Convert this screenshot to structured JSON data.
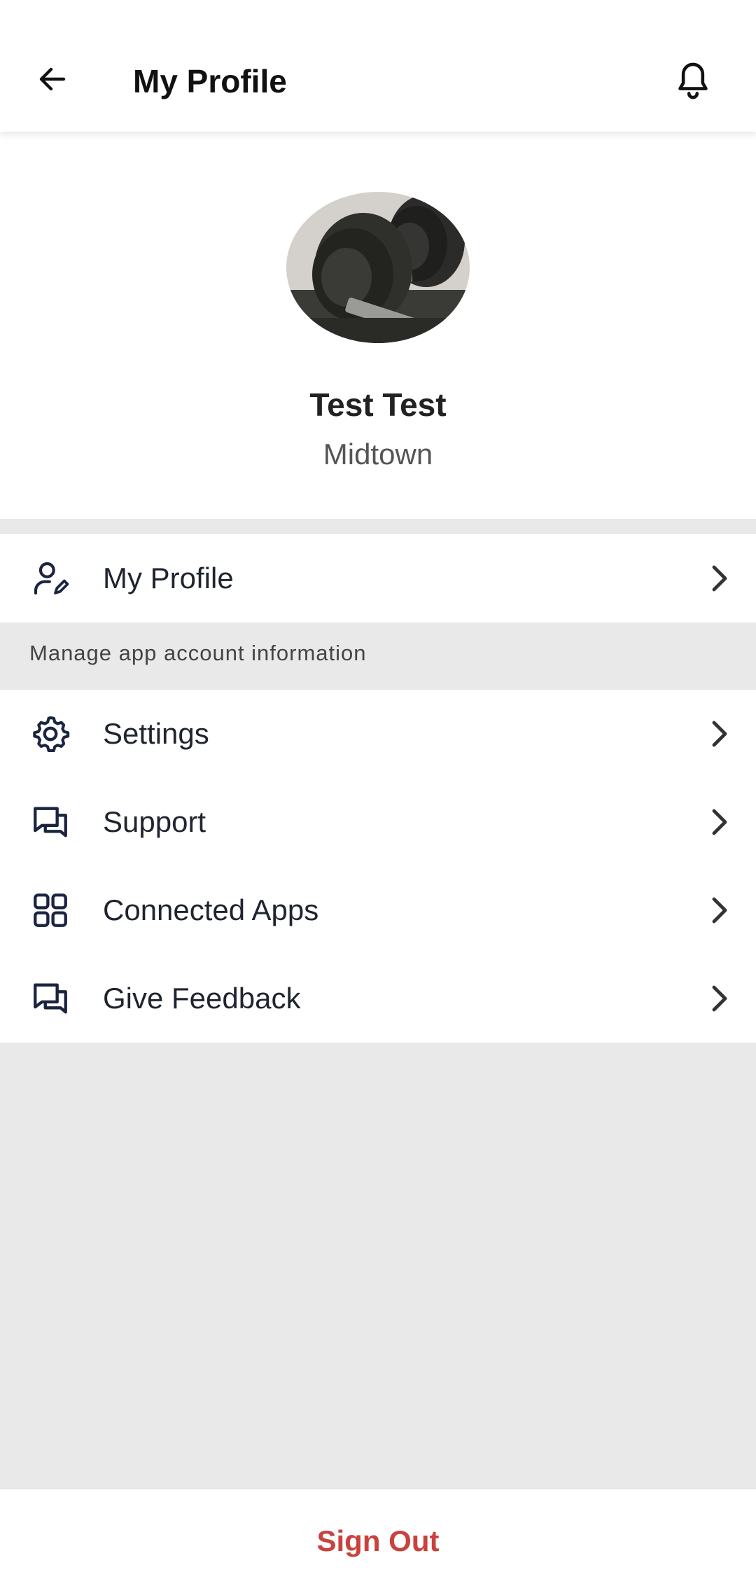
{
  "header": {
    "title": "My Profile",
    "back_icon": "arrow-left-icon",
    "notifications_icon": "bell-icon"
  },
  "profile": {
    "name": "Test Test",
    "location": "Midtown",
    "avatar_image": "dumbbells-photo"
  },
  "menu_primary": [
    {
      "label": "My Profile",
      "icon": "user-edit-icon"
    }
  ],
  "section_note": "Manage app account information",
  "menu_secondary": [
    {
      "label": "Settings",
      "icon": "gear-icon"
    },
    {
      "label": "Support",
      "icon": "chat-bubbles-icon"
    },
    {
      "label": "Connected Apps",
      "icon": "grid-icon"
    },
    {
      "label": "Give Feedback",
      "icon": "chat-bubbles-icon"
    }
  ],
  "footer": {
    "sign_out_label": "Sign Out"
  },
  "colors": {
    "accent_signout": "#c9423d",
    "icon_color": "#1b2440",
    "background_gray": "#e9e9e9"
  }
}
